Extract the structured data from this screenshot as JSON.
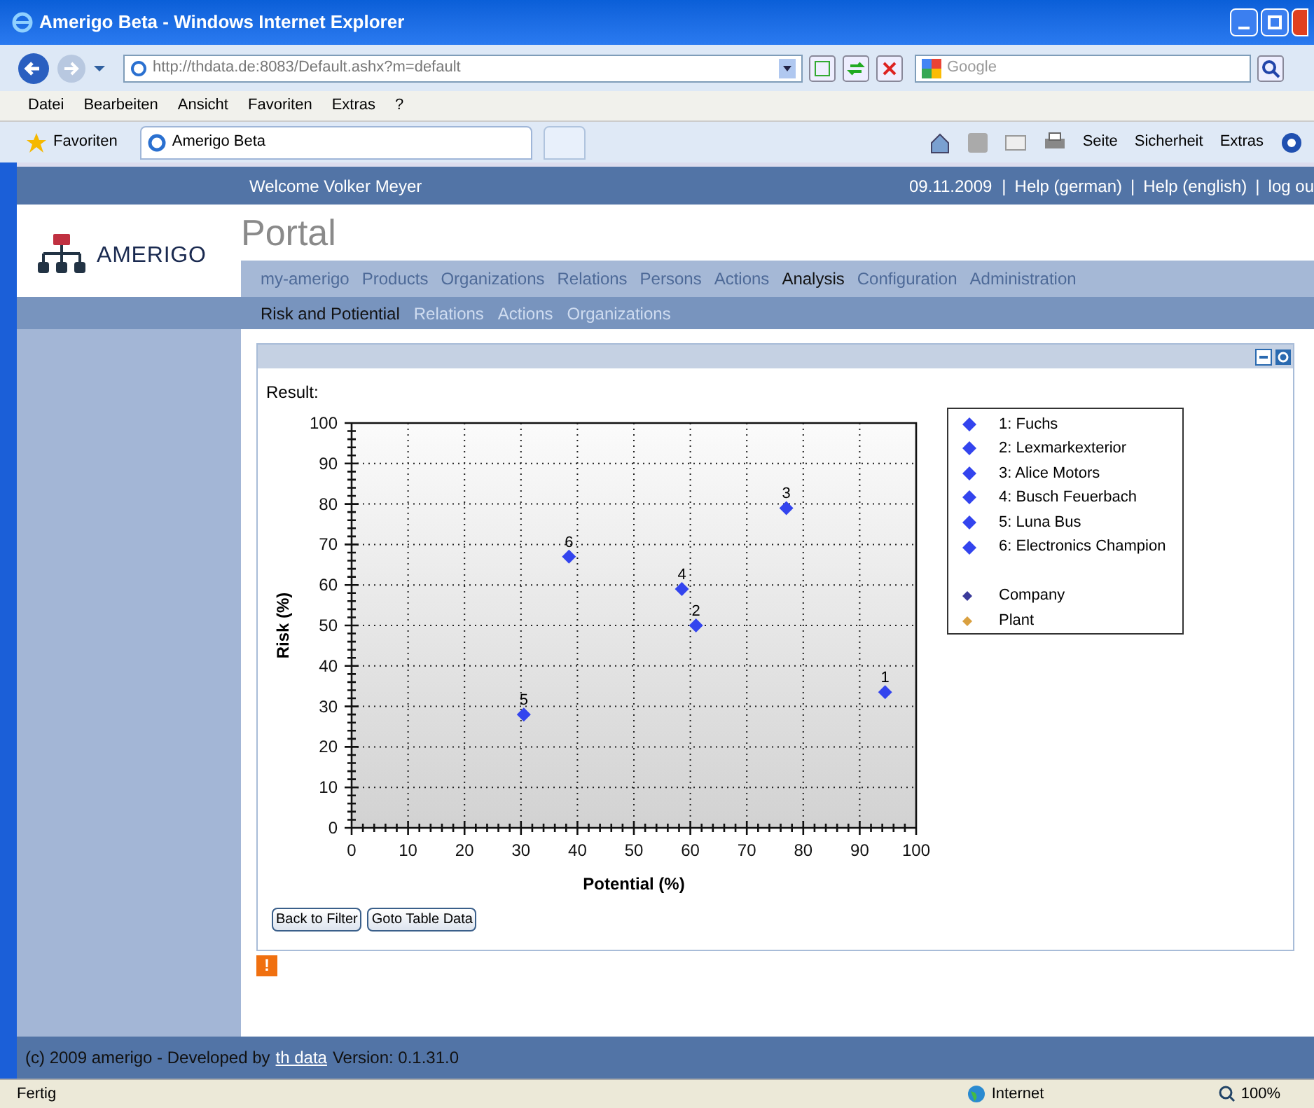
{
  "window": {
    "title": "Amerigo Beta - Windows Internet Explorer"
  },
  "address_bar": {
    "url": "http://thdata.de:8083/Default.ashx?m=default"
  },
  "search": {
    "placeholder": "Google"
  },
  "menu": [
    "Datei",
    "Bearbeiten",
    "Ansicht",
    "Favoriten",
    "Extras",
    "?"
  ],
  "favorites_button": "Favoriten",
  "tabs": [
    {
      "label": "Amerigo Beta",
      "selected": true
    }
  ],
  "command_bar": [
    "Seite",
    "Sicherheit",
    "Extras"
  ],
  "header": {
    "welcome": "Welcome Volker Meyer",
    "right": [
      {
        "kind": "text",
        "text": "09.11.2009"
      },
      {
        "kind": "sep",
        "text": "|"
      },
      {
        "kind": "link",
        "text": "Help (german)"
      },
      {
        "kind": "sep",
        "text": "|"
      },
      {
        "kind": "link",
        "text": "Help (english)"
      },
      {
        "kind": "sep",
        "text": "|"
      },
      {
        "kind": "link",
        "text": "log ou"
      }
    ]
  },
  "logo": "AMERIGO",
  "page_title": "Portal",
  "nav": [
    {
      "label": "my-amerigo",
      "selected": false
    },
    {
      "label": "Products",
      "selected": false
    },
    {
      "label": "Organizations",
      "selected": false
    },
    {
      "label": "Relations",
      "selected": false
    },
    {
      "label": "Persons",
      "selected": false
    },
    {
      "label": "Actions",
      "selected": false
    },
    {
      "label": "Analysis",
      "selected": true
    },
    {
      "label": "Configuration",
      "selected": false
    },
    {
      "label": "Administration",
      "selected": false
    }
  ],
  "subnav": [
    {
      "label": "Risk and Potiential",
      "selected": true
    },
    {
      "label": "Relations",
      "selected": false
    },
    {
      "label": "Actions",
      "selected": false
    },
    {
      "label": "Organizations",
      "selected": false
    }
  ],
  "result_label": "Result:",
  "chart": {
    "chart_data": {
      "type": "scatter",
      "xlabel": "Potential (%)",
      "ylabel": "Risk (%)",
      "xlim": [
        0,
        100
      ],
      "ylim": [
        0,
        100
      ],
      "xticks": [
        0,
        10,
        20,
        30,
        40,
        50,
        60,
        70,
        80,
        90,
        100
      ],
      "yticks": [
        0,
        10,
        20,
        30,
        40,
        50,
        60,
        70,
        80,
        90,
        100
      ],
      "x": [
        94.5,
        61,
        77,
        58.5,
        30.5,
        38.5
      ],
      "grid": true,
      "series": [
        {
          "color": "#3344ee",
          "values": [
            33.5,
            50,
            79,
            59,
            28,
            67
          ]
        }
      ],
      "value_labels": [
        "1",
        "2",
        "3",
        "4",
        "5",
        "6"
      ]
    }
  },
  "legend": {
    "items": [
      "1: Fuchs",
      "2: Lexmarkexterior",
      "3: Alice Motors",
      "4: Busch Feuerbach",
      "5: Luna Bus",
      "6: Electronics Champion"
    ],
    "types": [
      {
        "label": "Company",
        "color": "#3a3a9a"
      },
      {
        "label": "Plant",
        "color": "#d9a040"
      }
    ]
  },
  "buttons": [
    "Back to Filter",
    "Goto Table Data"
  ],
  "warning": "!",
  "footer": {
    "text": "(c) 2009 amerigo - Developed by",
    "link": "th data",
    "version": "Version: 0.1.31.0"
  },
  "status_bar": {
    "text": "Fertig",
    "zone": "Internet",
    "zoom": "100%"
  }
}
